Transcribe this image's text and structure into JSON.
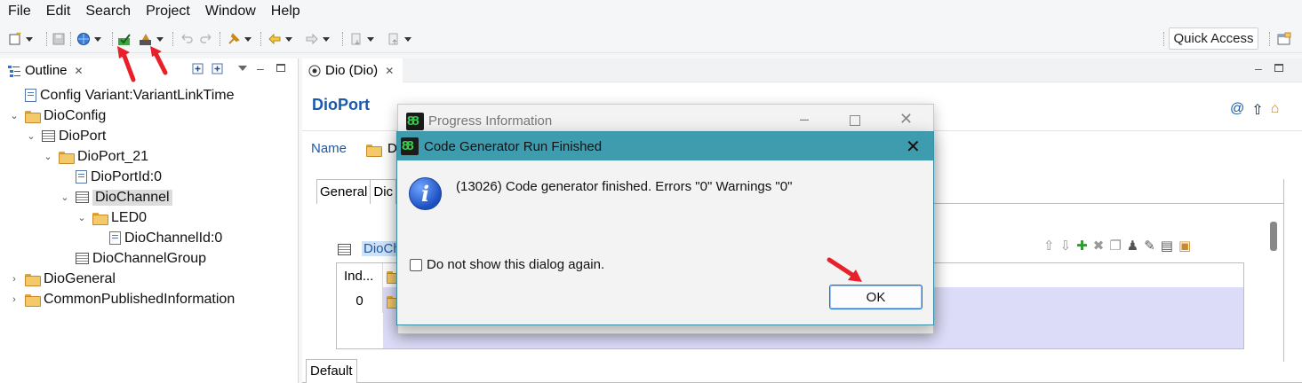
{
  "menu": [
    "File",
    "Edit",
    "Search",
    "Project",
    "Window",
    "Help"
  ],
  "toolbar": {
    "quick_access": "Quick Access",
    "icons": [
      "new-icon",
      "save-icon",
      "globe-icon",
      "validate-icon",
      "generate-icon",
      "undo-icon",
      "redo-icon",
      "pin-icon",
      "back-icon",
      "forward-icon",
      "next-annotation-icon",
      "prev-annotation-icon",
      "perspective-icon"
    ]
  },
  "outline": {
    "tab_title": "Outline",
    "tree": [
      {
        "label": "Config Variant:VariantLinkTime",
        "depth": 0,
        "icon": "doc-icon",
        "chevron": ""
      },
      {
        "label": "DioConfig",
        "depth": 0,
        "icon": "folder-icon",
        "chevron": "expanded"
      },
      {
        "label": "DioPort",
        "depth": 1,
        "icon": "table-icon",
        "chevron": "expanded"
      },
      {
        "label": "DioPort_21",
        "depth": 2,
        "icon": "folder-icon",
        "chevron": "expanded"
      },
      {
        "label": "DioPortId:0",
        "depth": 3,
        "icon": "doc-icon",
        "chevron": ""
      },
      {
        "label": "DioChannel",
        "depth": 3,
        "icon": "table-icon",
        "chevron": "expanded",
        "selected": true
      },
      {
        "label": "LED0",
        "depth": 4,
        "icon": "folder-icon",
        "chevron": "expanded"
      },
      {
        "label": "DioChannelId:0",
        "depth": 5,
        "icon": "doc-icon",
        "chevron": ""
      },
      {
        "label": "DioChannelGroup",
        "depth": 3,
        "icon": "table-icon",
        "chevron": ""
      },
      {
        "label": "DioGeneral",
        "depth": 0,
        "icon": "folder-icon",
        "chevron": "collapsed"
      },
      {
        "label": "CommonPublishedInformation",
        "depth": 0,
        "icon": "folder-icon",
        "chevron": "collapsed"
      }
    ]
  },
  "editor": {
    "tab_title": "Dio (Dio)",
    "page_title": "DioPort",
    "name_label": "Name",
    "name_value": "D",
    "subtabs": [
      "General",
      "Dic"
    ],
    "section_title": "DioCh",
    "grid_header": "Ind...",
    "grid_cell": "0",
    "bottom_tab": "Default"
  },
  "progress_dialog": {
    "title": "Progress Information"
  },
  "dialog": {
    "title": "Code Generator Run Finished",
    "message": "(13026) Code generator finished. Errors \"0\" Warnings \"0\"",
    "checkbox_label": "Do not show this dialog again.",
    "checkbox_checked": false,
    "ok_label": "OK"
  },
  "colors": {
    "dialog_titlebar": "#3e9cae",
    "accent_blue": "#1a5aa8",
    "arrow_red": "#e8202a"
  }
}
